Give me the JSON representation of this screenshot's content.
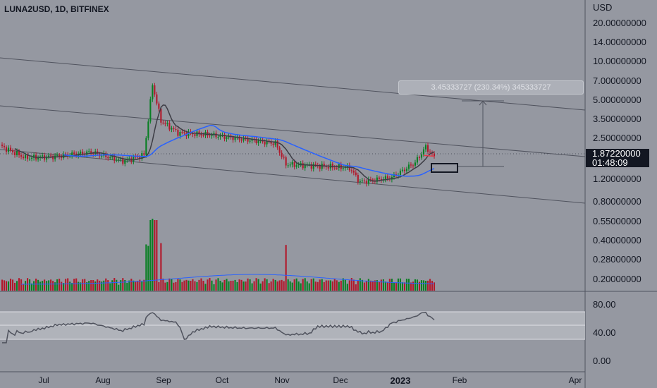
{
  "header": {
    "symbol_title": "LUNA2USD, 1D, BITFINEX"
  },
  "price_axis": {
    "currency_label": "USD",
    "ticks": [
      "20.00000000",
      "14.00000000",
      "10.00000000",
      "7.00000000",
      "5.00000000",
      "3.50000000",
      "2.50000000",
      "1.20000000",
      "0.80000000",
      "0.55000000",
      "0.40000000",
      "0.28000000",
      "0.20000000"
    ]
  },
  "last_price": {
    "value": "1.87220000",
    "countdown": "01:48:09",
    "background": "#131722"
  },
  "measure_tool": {
    "label": "3.45333727 (230.34%) 345333727"
  },
  "rsi_axis": {
    "ticks": [
      "80.00",
      "40.00",
      "0.00"
    ]
  },
  "time_axis": {
    "labels": [
      "Jul",
      "Aug",
      "Sep",
      "Oct",
      "Nov",
      "Dec",
      "2023",
      "Feb",
      "Apr"
    ]
  },
  "colors": {
    "background": "#9598a1",
    "candle_up": "#087f23",
    "candle_down": "#b2182b",
    "ma_fast": "#3d3d45",
    "ma_slow": "#2962ff",
    "ma_red": "#e53945",
    "channel_lines": "#50535e",
    "rsi_band": "#b0b3ba",
    "rsi_line": "#50535e",
    "axis_text": "#131722"
  },
  "chart_data": {
    "type": "candlestick",
    "title": "LUNA2USD, 1D, BITFINEX",
    "y_scale": "log",
    "y_unit": "USD",
    "x_range": [
      "Jun 2022",
      "Apr 2023"
    ],
    "series": [
      {
        "type": "ohlc",
        "values": [
          {
            "date": "2022-06-28",
            "close": 2.3
          },
          {
            "date": "2022-07-10",
            "close": 1.85
          },
          {
            "date": "2022-07-25",
            "close": 1.9
          },
          {
            "date": "2022-08-10",
            "close": 2.05
          },
          {
            "date": "2022-08-25",
            "close": 1.75
          },
          {
            "date": "2022-09-04",
            "close": 1.95
          },
          {
            "date": "2022-09-08",
            "close": 6.9
          },
          {
            "date": "2022-09-12",
            "close": 3.6
          },
          {
            "date": "2022-09-20",
            "close": 2.9
          },
          {
            "date": "2022-10-05",
            "close": 2.8
          },
          {
            "date": "2022-10-20",
            "close": 2.6
          },
          {
            "date": "2022-11-05",
            "close": 2.4
          },
          {
            "date": "2022-11-10",
            "close": 1.65
          },
          {
            "date": "2022-11-25",
            "close": 1.6
          },
          {
            "date": "2022-12-10",
            "close": 1.55
          },
          {
            "date": "2022-12-15",
            "close": 1.2
          },
          {
            "date": "2022-12-30",
            "close": 1.3
          },
          {
            "date": "2023-01-10",
            "close": 1.7
          },
          {
            "date": "2023-01-15",
            "close": 2.25
          },
          {
            "date": "2023-01-19",
            "close": 1.8722
          }
        ]
      }
    ],
    "volume_visible": true,
    "indicators": [
      "moving average (dark)",
      "moving average (blue)",
      "moving average (red)",
      "RSI"
    ],
    "measure": {
      "change": "3.45333727",
      "percent": "230.34%"
    },
    "rsi_levels": [
      80,
      40,
      0
    ],
    "rsi_band": [
      30,
      70
    ],
    "grid": false
  }
}
